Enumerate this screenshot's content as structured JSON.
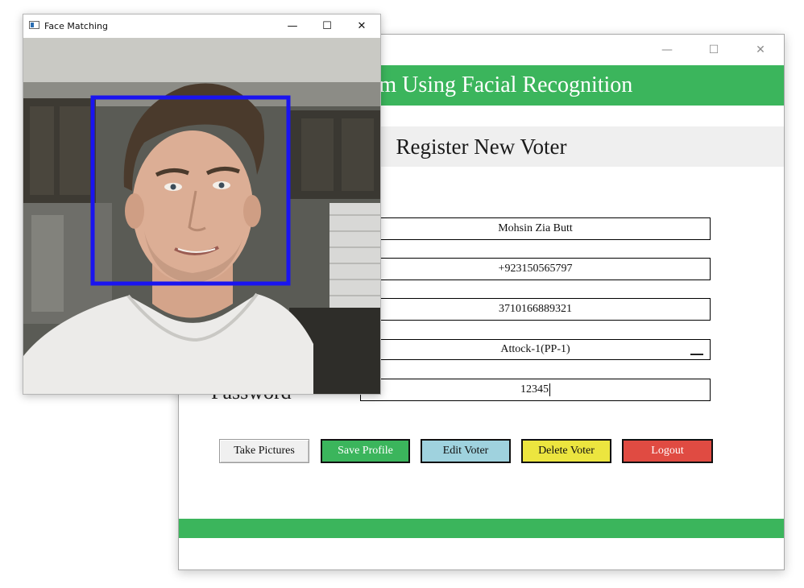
{
  "main_window": {
    "header_title": "System Using Facial Recognition",
    "section_title": "Register New Voter",
    "controls": {
      "minimize": "—",
      "maximize": "☐",
      "close": "✕"
    },
    "form": {
      "name_value": "Mohsin Zia Butt",
      "phone_value": "+923150565797",
      "cnic_value": "3710166889321",
      "constituency_value": "Attock-1(PP-1)",
      "password_label": "Password",
      "password_value": "12345"
    },
    "buttons": {
      "take_pictures": "Take Pictures",
      "save_profile": "Save Profile",
      "edit_voter": "Edit Voter",
      "delete_voter": "Delete Voter",
      "logout": "Logout"
    },
    "colors": {
      "accent_green": "#3bb55c",
      "edit_blue": "#9fd2de",
      "delete_yellow": "#ece53f",
      "logout_red": "#e04b42"
    }
  },
  "face_window": {
    "title": "Face Matching",
    "controls": {
      "minimize": "—",
      "maximize": "☐",
      "close": "✕"
    },
    "detection_box_color": "#1a14f0"
  }
}
